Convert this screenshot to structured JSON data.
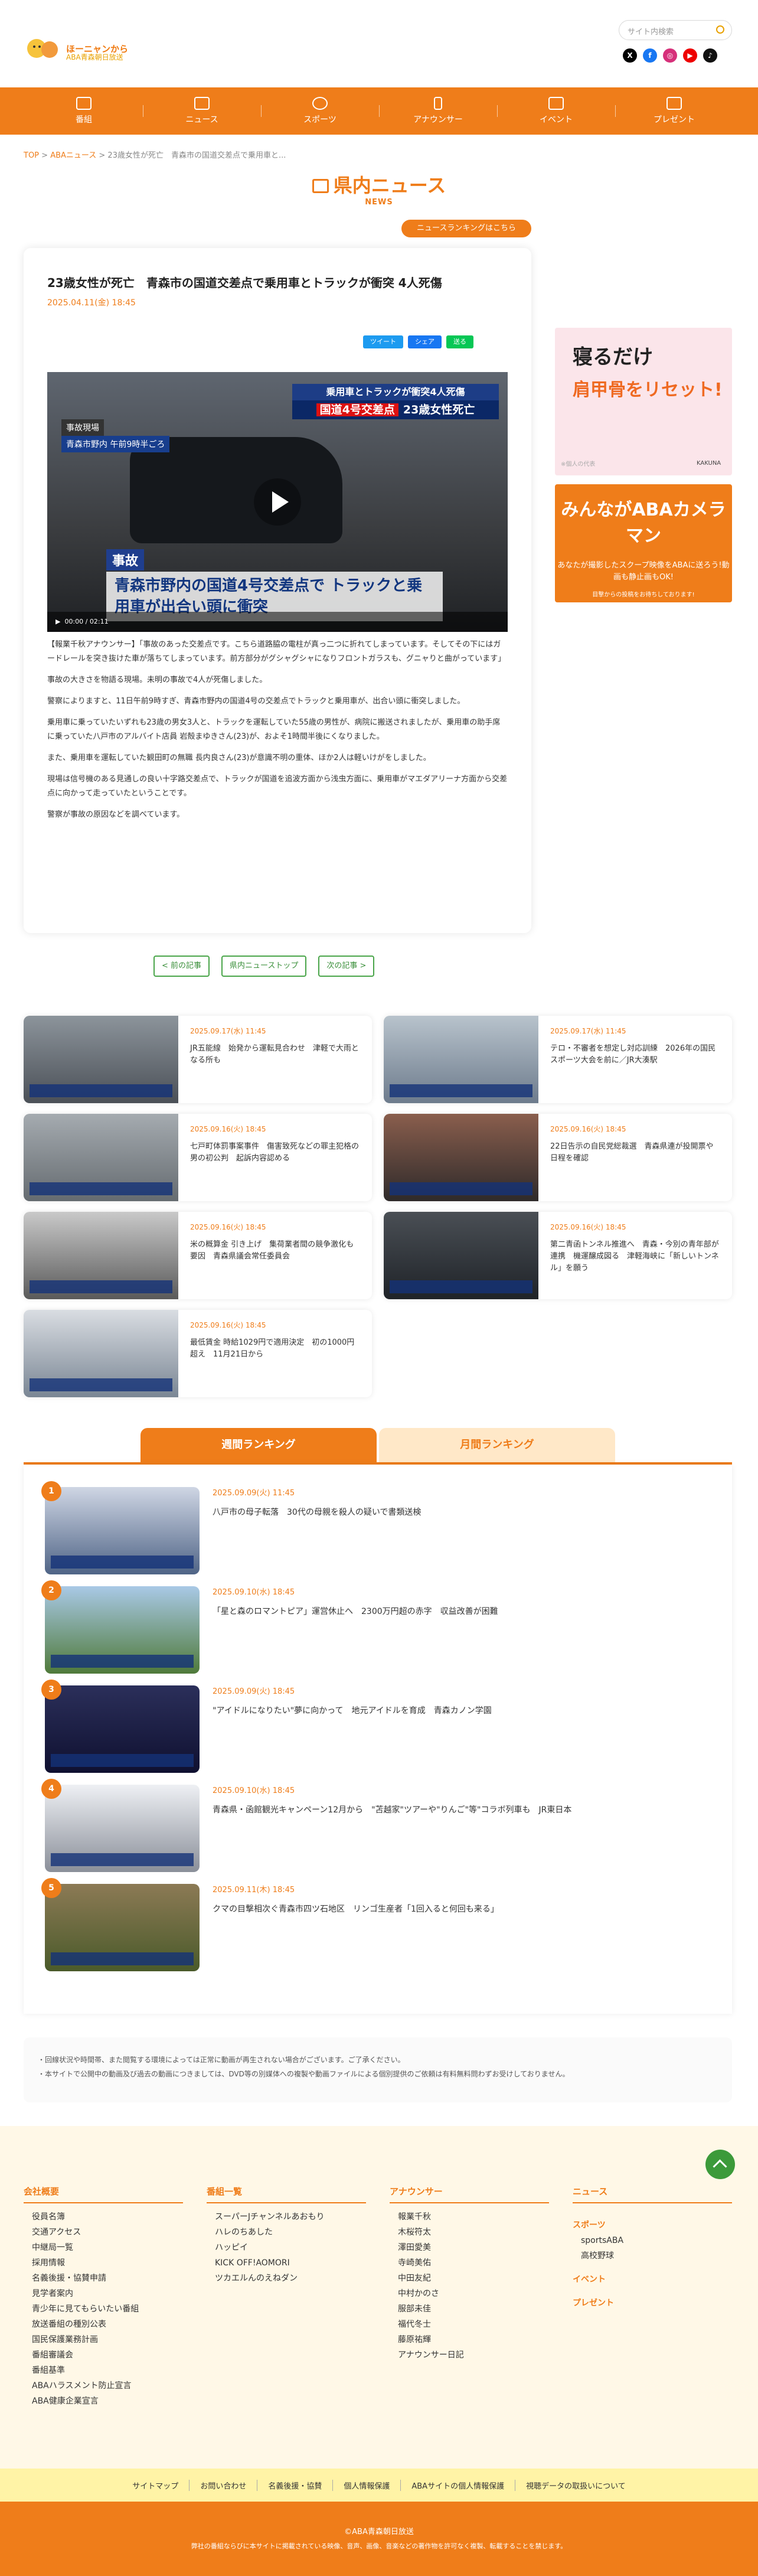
{
  "header": {
    "logo_text": "ほーニャンから",
    "logo_sub": "ABA青森朝日放送",
    "search_placeholder": "サイト内検索",
    "social": [
      "X",
      "f",
      "◎",
      "▶",
      "♪"
    ]
  },
  "nav": [
    "番組",
    "ニュース",
    "スポーツ",
    "アナウンサー",
    "イベント",
    "プレゼント"
  ],
  "breadcrumb": [
    "TOP",
    "ABAニュース",
    "23歳女性が死亡　青森市の国道交差点で乗用車と..."
  ],
  "section": {
    "title": "県内ニュース",
    "sub": "NEWS",
    "ranking_link": "ニュースランキングはこちら"
  },
  "article": {
    "title": "23歳女性が死亡　青森市の国道交差点で乗用車とトラックが衝突 4人死傷",
    "date": "2025.04.11(金) 18:45",
    "share": [
      "ツイート",
      "シェア",
      "送る"
    ],
    "video": {
      "cap_top": "乗用車とトラックが衝突4人死傷",
      "cap_tag": "国道4号交差点",
      "cap_top2": "23歳女性死亡",
      "cap_left": "事故現場",
      "cap_left2": "青森市野内 午前9時半ごろ",
      "label": "事故",
      "main": "青森市野内の国道4号交差点で トラックと乗用車が出合い頭に衝突",
      "time": "00:00 / 02:11"
    },
    "paragraphs": [
      "【報業千秋アナウンサー】「事故のあった交差点です。こちら道路脇の電柱が真っ二つに折れてしまっています。そしてその下にはガードレールを突き抜けた車が落ちてしまっています。前方部分がグシャグシャになりフロントガラスも、グニャりと曲がっています」",
      "事故の大きさを物語る現場。未明の事故で4人が死傷しました。",
      "警察によりますと、11日午前9時すぎ、青森市野内の国道4号の交差点でトラックと乗用車が、出合い頭に衝突しました。",
      "乗用車に乗っていたいずれも23歳の男女3人と、トラックを運転していた55歳の男性が、病院に搬送されましたが、乗用車の助手席に乗っていた八戸市のアルバイト店員 岩殻まゆきさん(23)が、およそ1時間半後にくなりました。",
      "また、乗用車を運転していた観田町の無職 長内良さん(23)が意識不明の重体、ほか2人は軽いけがをしました。",
      "現場は信号機のある見通しの良い十字路交差点で、トラックが国道を追波方面から浅虫方面に、乗用車がマエダアリーナ方面から交差点に向かって走っていたということです。",
      "警察が事故の原因などを調べています。"
    ]
  },
  "pager": [
    "< 前の記事",
    "県内ニューストップ",
    "次の記事 >"
  ],
  "ads": {
    "ad1_a": "寝るだけ",
    "ad1_b": "肩甲骨をリセット!",
    "ad1_c": "※個人の代表",
    "ad1_d": "KAKUNA",
    "ad2_a": "みんながABAカメラマン",
    "ad2_b": "あなたが撮影したスクープ映像をABAに送ろう!動画も静止画もOK!",
    "ad2_c": "目撃からの投稿をお待ちしております!"
  },
  "news": [
    {
      "date": "2025.09.17(水) 11:45",
      "title": "JR五能線　始発から運転見合わせ　津軽で大雨となる所も"
    },
    {
      "date": "2025.09.17(水) 11:45",
      "title": "テロ・不審者を想定し対応訓練　2026年の国民スポーツ大会を前に／JR大湊駅"
    },
    {
      "date": "2025.09.16(火) 18:45",
      "title": "七戸町体罰事案事件　傷害致死などの罪主犯格の男の初公判　起訴内容認める"
    },
    {
      "date": "2025.09.16(火) 18:45",
      "title": "22日告示の自民党総裁選　青森県連が投開票や日程を確認"
    },
    {
      "date": "2025.09.16(火) 18:45",
      "title": "米の概算金 引き上げ　集荷業者間の競争激化も要因　青森県議会常任委員会"
    },
    {
      "date": "2025.09.16(火) 18:45",
      "title": "第二青函トンネル推進へ　青森・今別の青年部が連携　機運醸成図る　津軽海峡に「新しいトンネル」を願う"
    },
    {
      "date": "2025.09.16(火) 18:45",
      "title": "最低賃金 時給1029円で適用決定　初の1000円超え　11月21日から"
    }
  ],
  "ranking": {
    "tabs": [
      "週間ランキング",
      "月間ランキング"
    ],
    "items": [
      {
        "num": "1",
        "date": "2025.09.09(火) 11:45",
        "title": "八戸市の母子転落　30代の母親を殺人の疑いで書類送検"
      },
      {
        "num": "2",
        "date": "2025.09.10(水) 18:45",
        "title": "「星と森のロマントピア」運営休止へ　2300万円超の赤字　収益改善が困難"
      },
      {
        "num": "3",
        "date": "2025.09.09(火) 18:45",
        "title": "\"アイドルになりたい\"夢に向かって　地元アイドルを育成　青森カノン学園"
      },
      {
        "num": "4",
        "date": "2025.09.10(水) 18:45",
        "title": "青森県・函館観光キャンペーン12月から　\"苫越家\"ツアーや\"りんご\"等\"コラボ列車も　JR東日本"
      },
      {
        "num": "5",
        "date": "2025.09.11(木) 18:45",
        "title": "クマの目撃相次ぐ青森市四ツ石地区　リンゴ生産者「1回入ると何回も来る」"
      }
    ]
  },
  "notice": [
    "・回線状況や時間帯、また閲覧する環境によっては正常に動画が再生されない場合がございます。ご了承ください。",
    "・本サイトで公開中の動画及び過去の動画につきましては、DVD等の別媒体への複製や動画ファイルによる個別提供のご依頼は有料無料問わずお受けしておりません。"
  ],
  "footer": {
    "cols": [
      {
        "h": "会社概要",
        "items": [
          "役員名簿",
          "交通アクセス",
          "中継局一覧",
          "採用情報",
          "名義後援・協賛申請",
          "見学者案内",
          "青少年に見てもらいたい番組",
          "放送番組の種別公表",
          "国民保護業務計画",
          "番組審議会",
          "番組基準",
          "ABAハラスメント防止宣言",
          "ABA健康企業宣言"
        ]
      },
      {
        "h": "番組一覧",
        "items": [
          "スーパーJチャンネルあおもり",
          "ハレのちあした",
          "ハッピイ",
          "KICK OFF!AOMORI",
          "ツカエルんのえねダン"
        ]
      },
      {
        "h": "アナウンサー",
        "items": [
          "報業千秋",
          "木桜符太",
          "澤田愛美",
          "寺崎美佑",
          "中田友紀",
          "中村かのさ",
          "服部未佳",
          "福代冬士",
          "藤原祐輝",
          "アナウンサー日記"
        ]
      }
    ],
    "col4": {
      "h": "ニュース",
      "sports": "スポーツ",
      "sports_items": [
        "sportsABA",
        "高校野球"
      ],
      "event": "イベント",
      "present": "プレゼント"
    },
    "links": [
      "サイトマップ",
      "お問い合わせ",
      "名義後援・協賛",
      "個人情報保護",
      "ABAサイトの個人情報保護",
      "視聴データの取扱いについて"
    ],
    "copyright": "©ABA青森朝日放送",
    "note": "弊社の番組ならびに本サイトに掲載されている映像、音声、画像、音楽などの著作物を許可なく複製、転載することを禁じます。"
  }
}
